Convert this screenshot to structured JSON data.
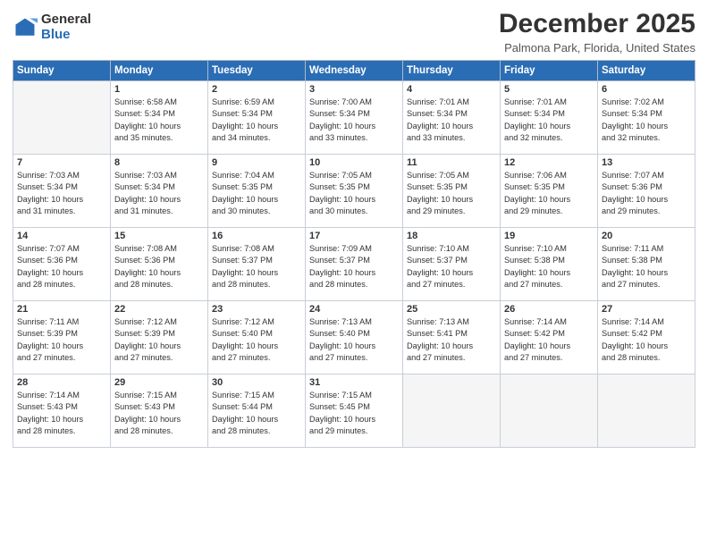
{
  "logo": {
    "general": "General",
    "blue": "Blue"
  },
  "header": {
    "title": "December 2025",
    "location": "Palmona Park, Florida, United States"
  },
  "weekdays": [
    "Sunday",
    "Monday",
    "Tuesday",
    "Wednesday",
    "Thursday",
    "Friday",
    "Saturday"
  ],
  "weeks": [
    [
      {
        "day": "",
        "text": ""
      },
      {
        "day": "1",
        "text": "Sunrise: 6:58 AM\nSunset: 5:34 PM\nDaylight: 10 hours\nand 35 minutes."
      },
      {
        "day": "2",
        "text": "Sunrise: 6:59 AM\nSunset: 5:34 PM\nDaylight: 10 hours\nand 34 minutes."
      },
      {
        "day": "3",
        "text": "Sunrise: 7:00 AM\nSunset: 5:34 PM\nDaylight: 10 hours\nand 33 minutes."
      },
      {
        "day": "4",
        "text": "Sunrise: 7:01 AM\nSunset: 5:34 PM\nDaylight: 10 hours\nand 33 minutes."
      },
      {
        "day": "5",
        "text": "Sunrise: 7:01 AM\nSunset: 5:34 PM\nDaylight: 10 hours\nand 32 minutes."
      },
      {
        "day": "6",
        "text": "Sunrise: 7:02 AM\nSunset: 5:34 PM\nDaylight: 10 hours\nand 32 minutes."
      }
    ],
    [
      {
        "day": "7",
        "text": "Sunrise: 7:03 AM\nSunset: 5:34 PM\nDaylight: 10 hours\nand 31 minutes."
      },
      {
        "day": "8",
        "text": "Sunrise: 7:03 AM\nSunset: 5:34 PM\nDaylight: 10 hours\nand 31 minutes."
      },
      {
        "day": "9",
        "text": "Sunrise: 7:04 AM\nSunset: 5:35 PM\nDaylight: 10 hours\nand 30 minutes."
      },
      {
        "day": "10",
        "text": "Sunrise: 7:05 AM\nSunset: 5:35 PM\nDaylight: 10 hours\nand 30 minutes."
      },
      {
        "day": "11",
        "text": "Sunrise: 7:05 AM\nSunset: 5:35 PM\nDaylight: 10 hours\nand 29 minutes."
      },
      {
        "day": "12",
        "text": "Sunrise: 7:06 AM\nSunset: 5:35 PM\nDaylight: 10 hours\nand 29 minutes."
      },
      {
        "day": "13",
        "text": "Sunrise: 7:07 AM\nSunset: 5:36 PM\nDaylight: 10 hours\nand 29 minutes."
      }
    ],
    [
      {
        "day": "14",
        "text": "Sunrise: 7:07 AM\nSunset: 5:36 PM\nDaylight: 10 hours\nand 28 minutes."
      },
      {
        "day": "15",
        "text": "Sunrise: 7:08 AM\nSunset: 5:36 PM\nDaylight: 10 hours\nand 28 minutes."
      },
      {
        "day": "16",
        "text": "Sunrise: 7:08 AM\nSunset: 5:37 PM\nDaylight: 10 hours\nand 28 minutes."
      },
      {
        "day": "17",
        "text": "Sunrise: 7:09 AM\nSunset: 5:37 PM\nDaylight: 10 hours\nand 28 minutes."
      },
      {
        "day": "18",
        "text": "Sunrise: 7:10 AM\nSunset: 5:37 PM\nDaylight: 10 hours\nand 27 minutes."
      },
      {
        "day": "19",
        "text": "Sunrise: 7:10 AM\nSunset: 5:38 PM\nDaylight: 10 hours\nand 27 minutes."
      },
      {
        "day": "20",
        "text": "Sunrise: 7:11 AM\nSunset: 5:38 PM\nDaylight: 10 hours\nand 27 minutes."
      }
    ],
    [
      {
        "day": "21",
        "text": "Sunrise: 7:11 AM\nSunset: 5:39 PM\nDaylight: 10 hours\nand 27 minutes."
      },
      {
        "day": "22",
        "text": "Sunrise: 7:12 AM\nSunset: 5:39 PM\nDaylight: 10 hours\nand 27 minutes."
      },
      {
        "day": "23",
        "text": "Sunrise: 7:12 AM\nSunset: 5:40 PM\nDaylight: 10 hours\nand 27 minutes."
      },
      {
        "day": "24",
        "text": "Sunrise: 7:13 AM\nSunset: 5:40 PM\nDaylight: 10 hours\nand 27 minutes."
      },
      {
        "day": "25",
        "text": "Sunrise: 7:13 AM\nSunset: 5:41 PM\nDaylight: 10 hours\nand 27 minutes."
      },
      {
        "day": "26",
        "text": "Sunrise: 7:14 AM\nSunset: 5:42 PM\nDaylight: 10 hours\nand 27 minutes."
      },
      {
        "day": "27",
        "text": "Sunrise: 7:14 AM\nSunset: 5:42 PM\nDaylight: 10 hours\nand 28 minutes."
      }
    ],
    [
      {
        "day": "28",
        "text": "Sunrise: 7:14 AM\nSunset: 5:43 PM\nDaylight: 10 hours\nand 28 minutes."
      },
      {
        "day": "29",
        "text": "Sunrise: 7:15 AM\nSunset: 5:43 PM\nDaylight: 10 hours\nand 28 minutes."
      },
      {
        "day": "30",
        "text": "Sunrise: 7:15 AM\nSunset: 5:44 PM\nDaylight: 10 hours\nand 28 minutes."
      },
      {
        "day": "31",
        "text": "Sunrise: 7:15 AM\nSunset: 5:45 PM\nDaylight: 10 hours\nand 29 minutes."
      },
      {
        "day": "",
        "text": ""
      },
      {
        "day": "",
        "text": ""
      },
      {
        "day": "",
        "text": ""
      }
    ]
  ]
}
